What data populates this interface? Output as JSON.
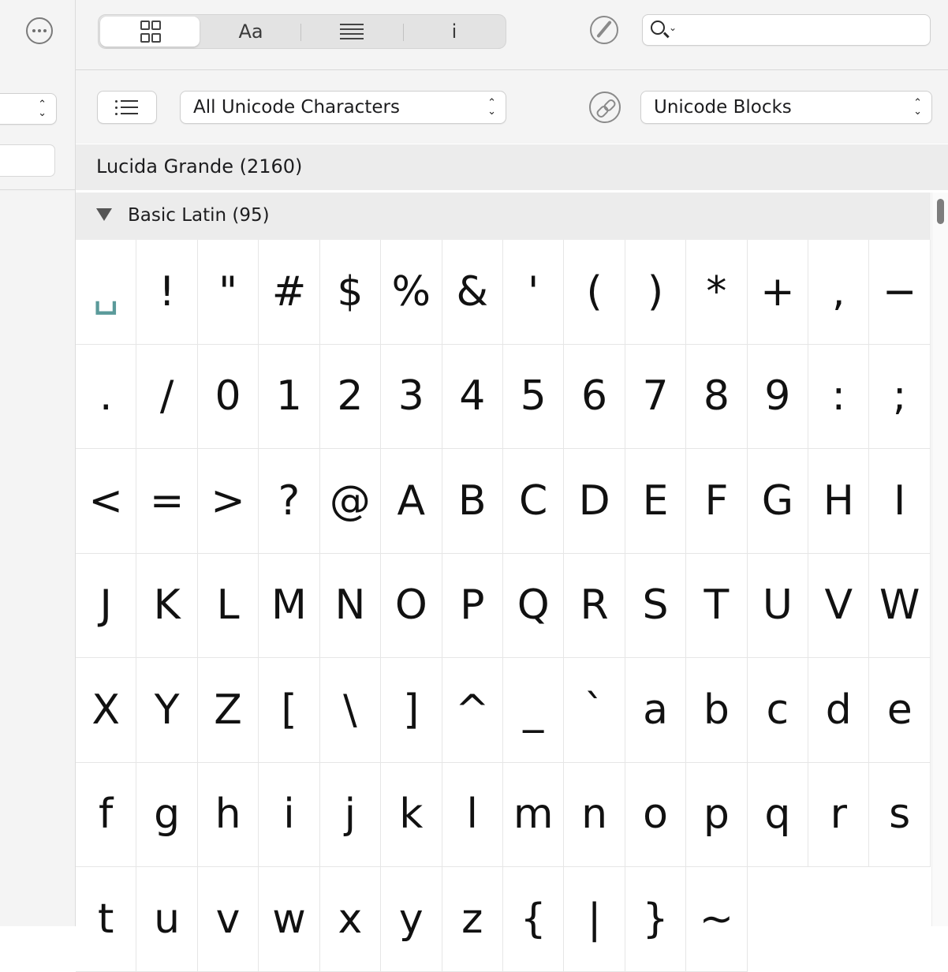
{
  "sidebar": {
    "more_icon": "ellipsis-circle-icon",
    "popup_chevron": "⌃⌄"
  },
  "toolbar": {
    "segments": [
      {
        "name": "grid",
        "icon": "grid-icon",
        "active": true
      },
      {
        "name": "font-text",
        "label": "Aa"
      },
      {
        "name": "lines",
        "icon": "text-lines-icon"
      },
      {
        "name": "info",
        "label": "i"
      }
    ],
    "search": {
      "placeholder": ""
    }
  },
  "filterbar": {
    "collection_popup": "All Unicode Characters",
    "grouping_popup": "Unicode Blocks",
    "chevron": "⌃⌄"
  },
  "font_header": "Lucida Grande (2160)",
  "block_header": "Basic Latin (95)",
  "glyphs": [
    "␣",
    "!",
    "\"",
    "#",
    "$",
    "%",
    "&",
    "'",
    "(",
    ")",
    "*",
    "+",
    ",",
    "−",
    ".",
    "/",
    "0",
    "1",
    "2",
    "3",
    "4",
    "5",
    "6",
    "7",
    "8",
    "9",
    ":",
    ";",
    "<",
    "=",
    ">",
    "?",
    "@",
    "A",
    "B",
    "C",
    "D",
    "E",
    "F",
    "G",
    "H",
    "I",
    "J",
    "K",
    "L",
    "M",
    "N",
    "O",
    "P",
    "Q",
    "R",
    "S",
    "T",
    "U",
    "V",
    "W",
    "X",
    "Y",
    "Z",
    "[",
    "\\",
    "]",
    "^",
    "_",
    "`",
    "a",
    "b",
    "c",
    "d",
    "e",
    "f",
    "g",
    "h",
    "i",
    "j",
    "k",
    "l",
    "m",
    "n",
    "o",
    "p",
    "q",
    "r",
    "s",
    "t",
    "u",
    "v",
    "w",
    "x",
    "y",
    "z",
    "{",
    "|",
    "}",
    "~"
  ],
  "colors": {
    "space_glyph": "#5a9a9a",
    "chrome_bg": "#f4f4f4"
  }
}
